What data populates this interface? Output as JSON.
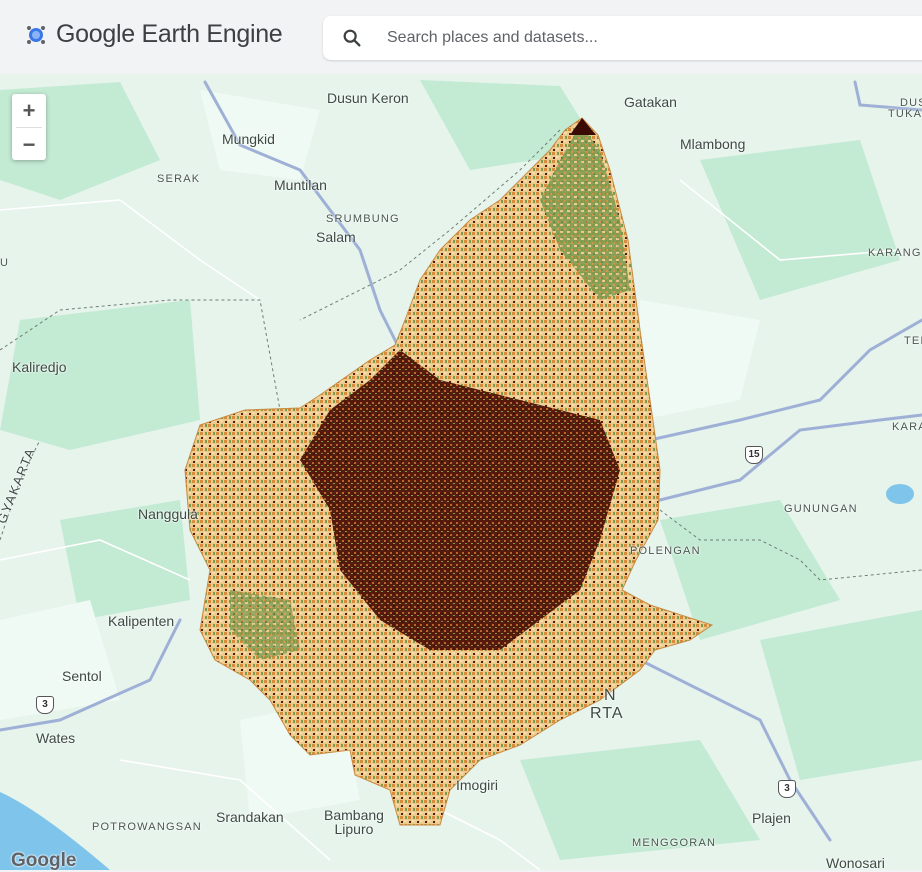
{
  "app": {
    "title": "Google Earth Engine"
  },
  "search": {
    "placeholder": "Search places and datasets..."
  },
  "zoom": {
    "in_label": "+",
    "out_label": "−"
  },
  "map": {
    "attribution": "Google",
    "labels": {
      "dusun_keron": "Dusun Keron",
      "gatakan": "Gatakan",
      "mungkid": "Mungkid",
      "mlambong": "Mlambong",
      "serak": "SERAK",
      "muntilan": "Muntilan",
      "srumbung": "SRUMBUNG",
      "salam": "Salam",
      "karang": "KARANG",
      "kaliredjo": "Kaliredjo",
      "kara": "KARA",
      "nanggulan": "Nanggula",
      "gunungan": "GUNUNGAN",
      "polengan": "POLENGAN",
      "kalipenten": "Kalipenten",
      "sentol": "Sentol",
      "wates": "Wates",
      "imogiri": "Imogiri",
      "potrowangsan": "POTROWANGSAN",
      "srandakan": "Srandakan",
      "bambang_lipuro": "Bambang\nLipuro",
      "plajen": "Plajen",
      "menggoran": "MENGGORAN",
      "wonosari": "Wonosari",
      "yogyakarta_partial": "GYAKARTA",
      "dusun_partial": "DUS",
      "tukan_partial": "TUKAN",
      "ter_partial": "TER",
      "u_partial": "U",
      "rta_partial": "RTA",
      "n_partial": "N"
    },
    "route_shields": {
      "r15": "15",
      "r3a": "3",
      "r3b": "3"
    }
  },
  "colors": {
    "land": "#e6f4ec",
    "forest": "#c7ecd7",
    "road": "#a4b3d6",
    "water": "#7fc4ea",
    "overlay_dark": "#4a0d05",
    "overlay_mid": "#d98a3a",
    "overlay_light": "#f6dca4",
    "overlay_green": "#7a9a4e"
  }
}
